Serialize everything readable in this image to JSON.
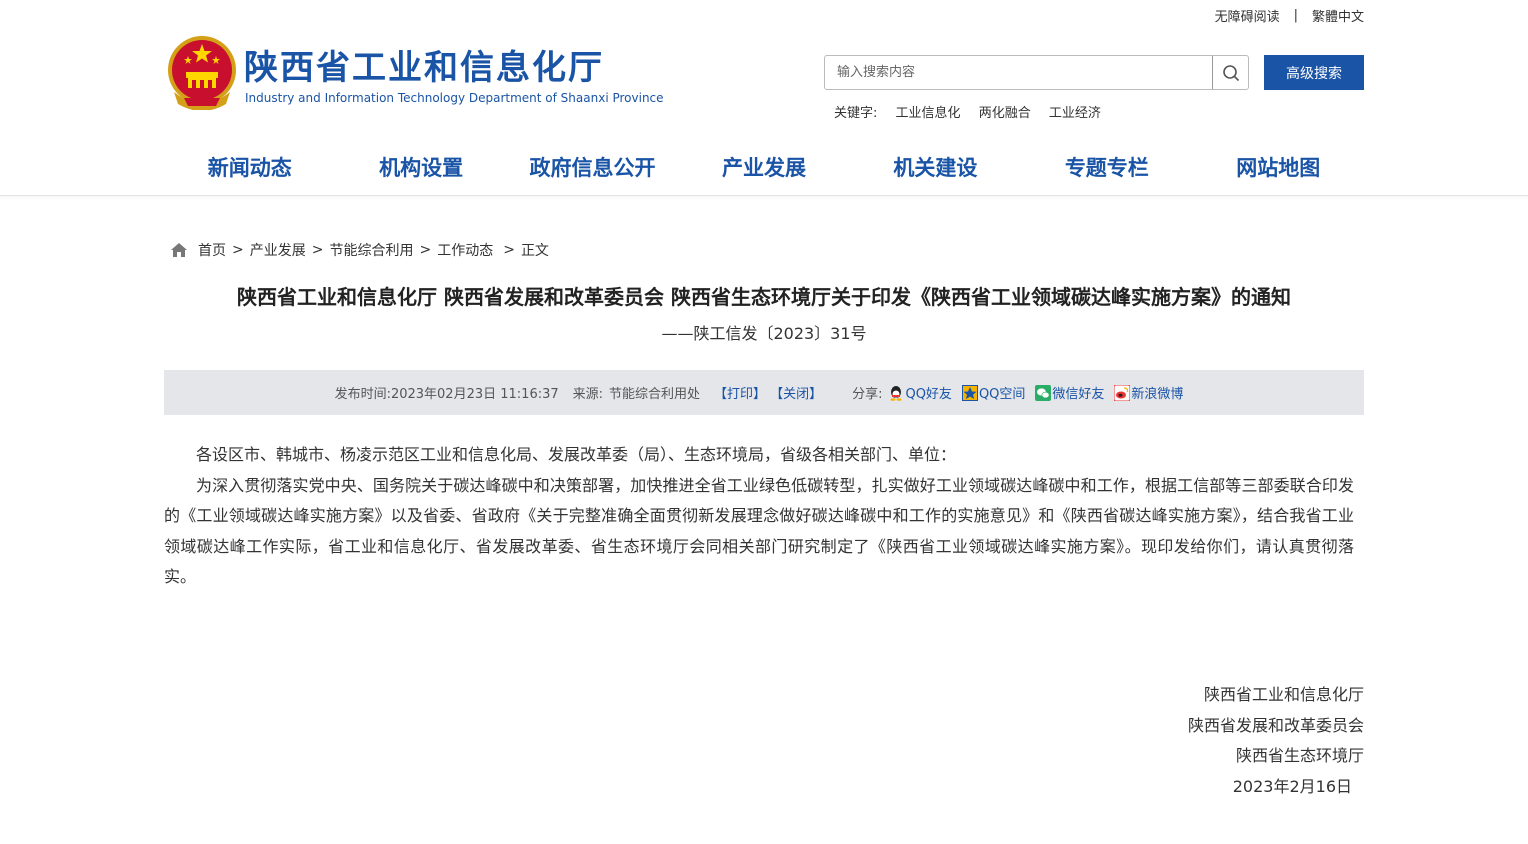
{
  "topbar": {
    "accessibility": "无障碍阅读",
    "separator": "|",
    "traditional": "繁體中文"
  },
  "header": {
    "title": "陕西省工业和信息化厅",
    "subtitle": "Industry and Information Technology Department of Shaanxi Province",
    "emblem_icon": "national-emblem-icon"
  },
  "search": {
    "placeholder": "输入搜索内容",
    "advanced_label": "高级搜索",
    "keywords_label": "关键字:",
    "keywords": [
      "工业信息化",
      "两化融合",
      "工业经济"
    ]
  },
  "nav": {
    "items": [
      "新闻动态",
      "机构设置",
      "政府信息公开",
      "产业发展",
      "机关建设",
      "专题专栏",
      "网站地图"
    ]
  },
  "breadcrumb": {
    "items": [
      "首页",
      "产业发展",
      "节能综合利用",
      "工作动态",
      "正文"
    ],
    "sep": ">"
  },
  "article": {
    "title": "陕西省工业和信息化厅 陕西省发展和改革委员会 陕西省生态环境厅关于印发《陕西省工业领域碳达峰实施方案》的通知",
    "doc_no": "——陕工信发〔2023〕31号",
    "meta": {
      "publish_label": "发布时间:",
      "publish_time": "2023年02月23日 11:16:37",
      "source_label": "来源:",
      "source": "节能综合利用处",
      "print": "【打印】",
      "close": "【关闭】",
      "share_label": "分享:",
      "share": [
        "QQ好友",
        "QQ空间",
        "微信好友",
        "新浪微博"
      ]
    },
    "paragraphs": [
      "各设区市、韩城市、杨凌示范区工业和信息化局、发展改革委（局）、生态环境局，省级各相关部门、单位：",
      "为深入贯彻落实党中央、国务院关于碳达峰碳中和决策部署，加快推进全省工业绿色低碳转型，扎实做好工业领域碳达峰碳中和工作，根据工信部等三部委联合印发的《工业领域碳达峰实施方案》以及省委、省政府《关于完整准确全面贯彻新发展理念做好碳达峰碳中和工作的实施意见》和《陕西省碳达峰实施方案》，结合我省工业领域碳达峰工作实际，省工业和信息化厅、省发展改革委、省生态环境厅会同相关部门研究制定了《陕西省工业领域碳达峰实施方案》。现印发给你们，请认真贯彻落实。"
    ],
    "signature": [
      "陕西省工业和信息化厅",
      "陕西省发展和改革委员会",
      "陕西省生态环境厅",
      "2023年2月16日"
    ]
  },
  "colors": {
    "brand_blue": "#1a54a6",
    "meta_bg": "#e4e6ea"
  }
}
